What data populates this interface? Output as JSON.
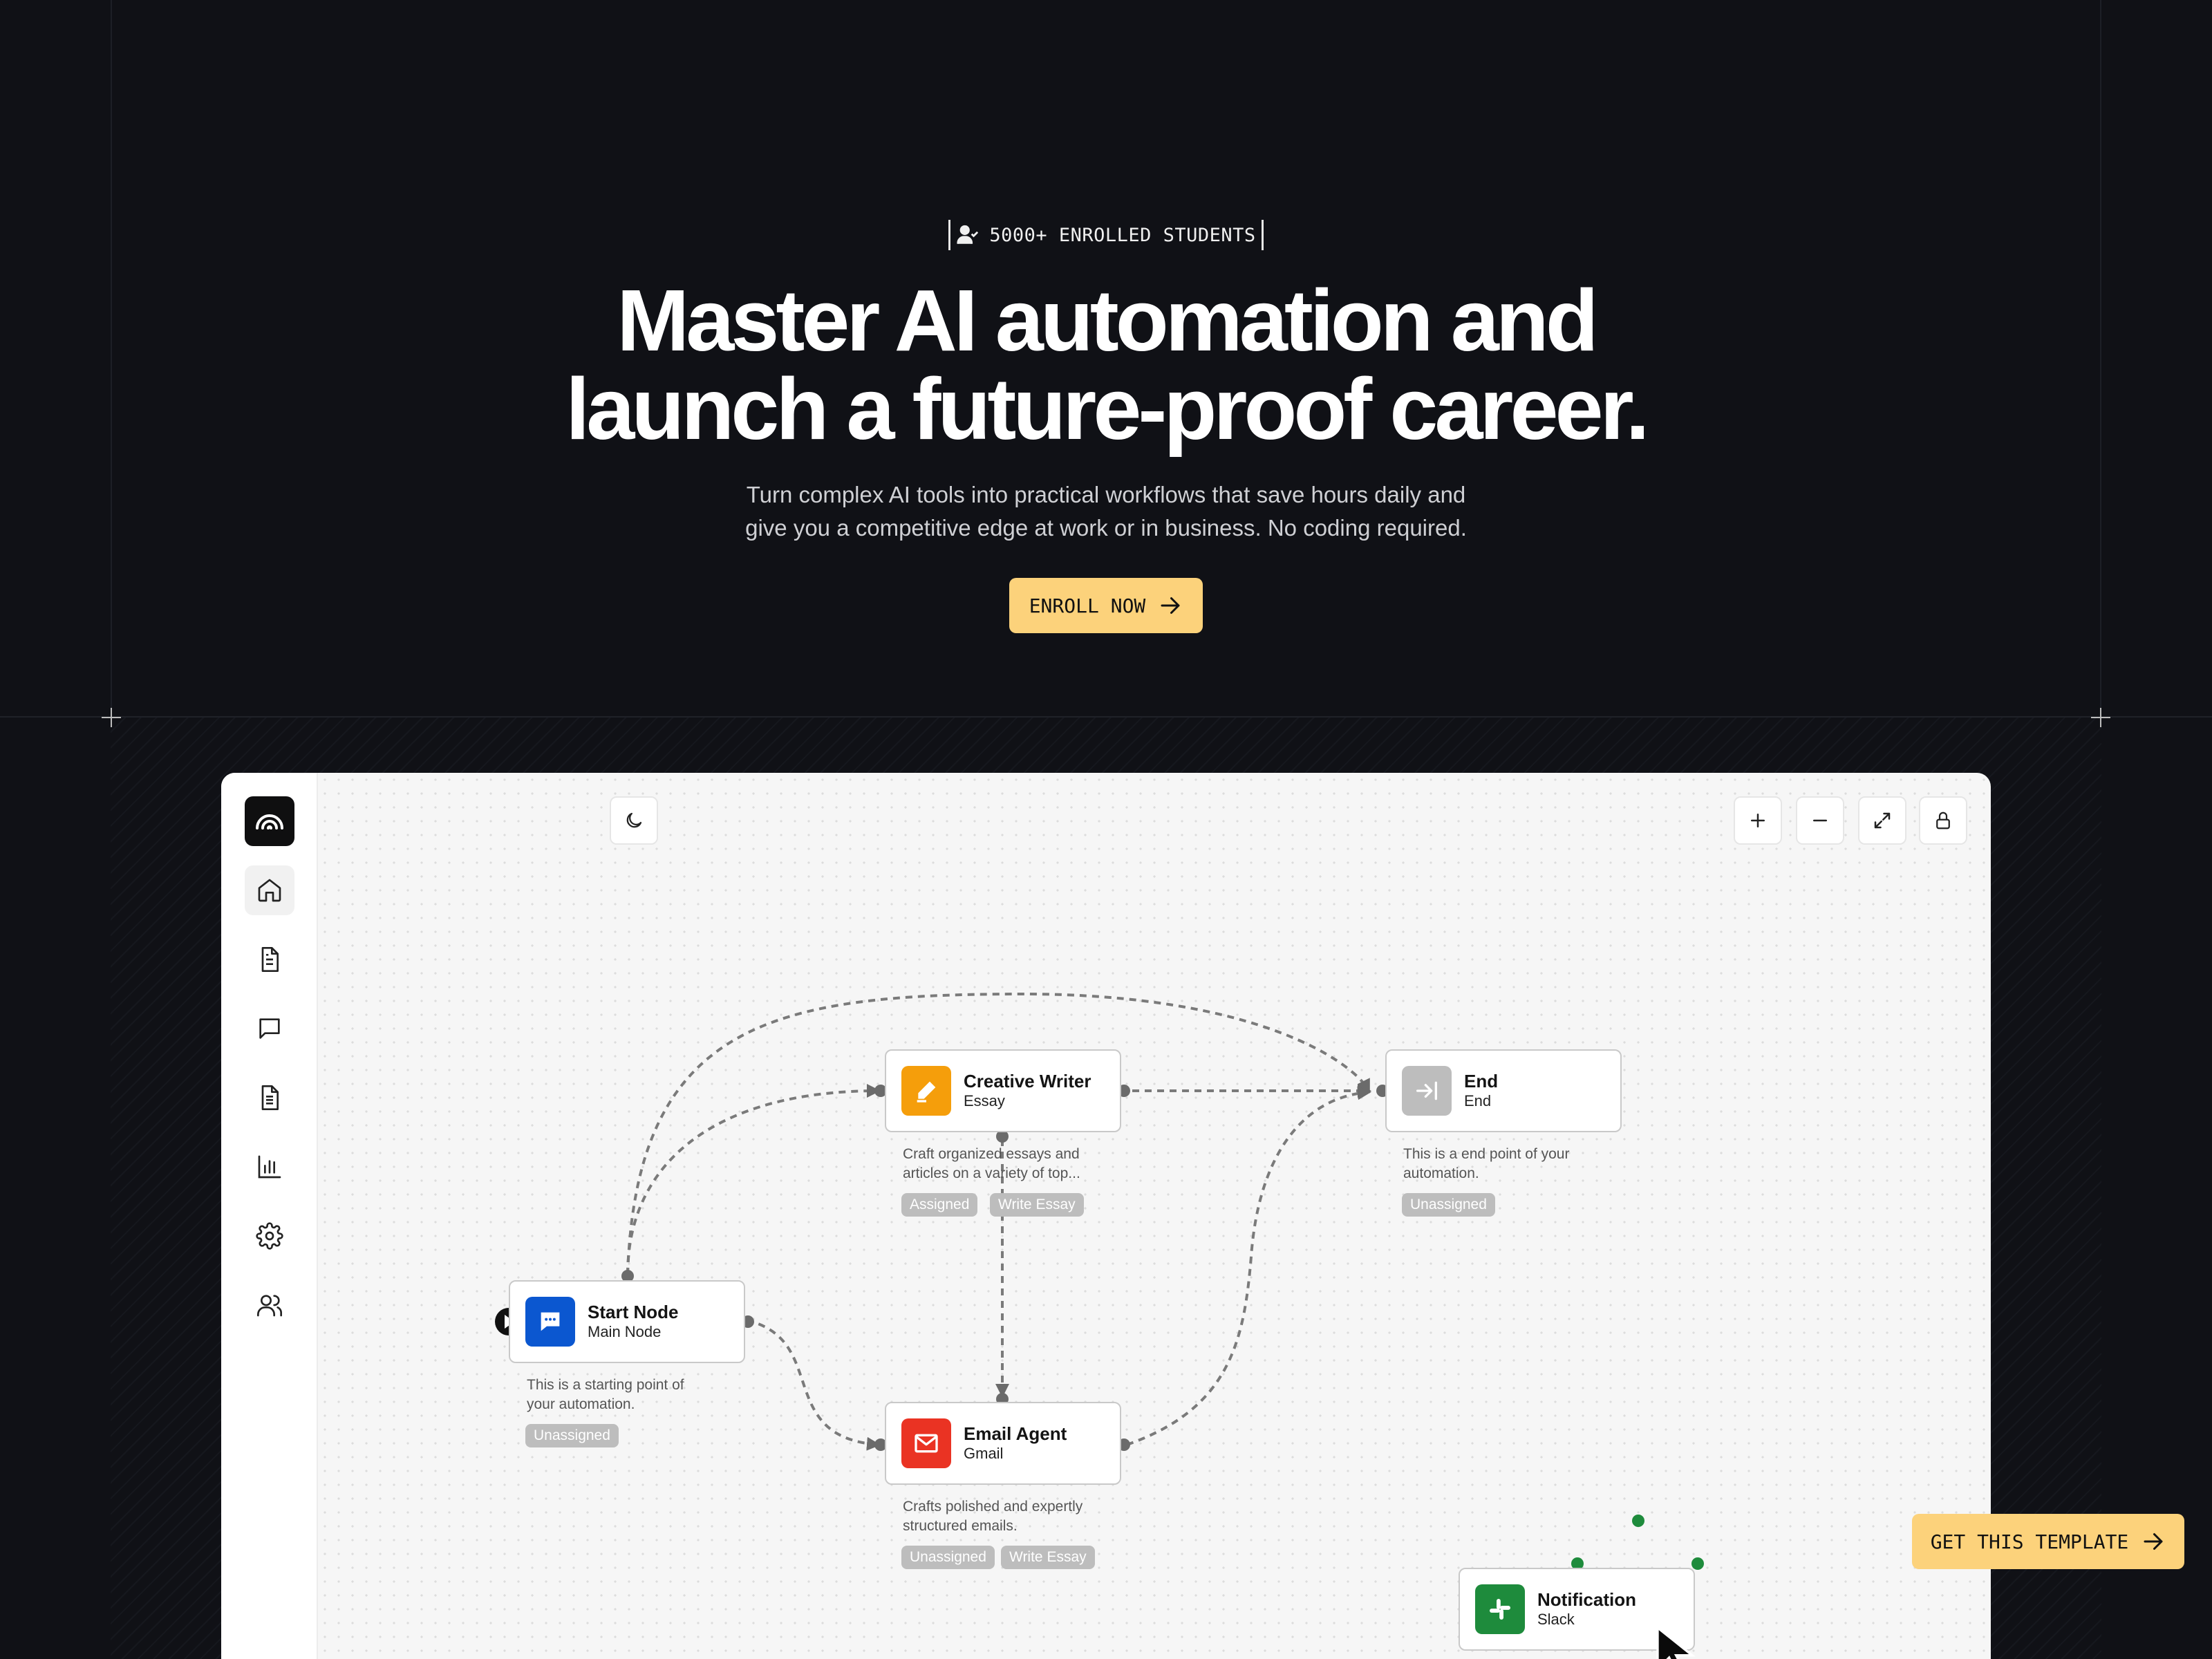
{
  "hero": {
    "badge_text": "5000+ ENROLLED STUDENTS",
    "title_line1": "Master AI automation and",
    "title_line2": "launch a future-proof career.",
    "subtitle_line1": "Turn complex AI tools into practical workflows that save hours daily and",
    "subtitle_line2": "give you a competitive edge at work or in business. No coding required.",
    "cta_label": "ENROLL NOW"
  },
  "sidebar": {
    "items": [
      {
        "icon": "home-icon"
      },
      {
        "icon": "document-icon"
      },
      {
        "icon": "chat-icon"
      },
      {
        "icon": "file-text-icon"
      },
      {
        "icon": "chart-icon"
      },
      {
        "icon": "settings-icon"
      },
      {
        "icon": "users-icon"
      }
    ]
  },
  "toolbar": {
    "theme_icon": "moon-icon",
    "zoom_in_icon": "plus-icon",
    "zoom_out_icon": "minus-icon",
    "fit_icon": "expand-icon",
    "lock_icon": "lock-icon"
  },
  "nodes": {
    "creative": {
      "title": "Creative Writer",
      "subtitle": "Essay",
      "desc_line1": "Craft organized essays and",
      "desc_line2": "articles on a variety of top...",
      "tags": [
        "Assigned",
        "Write Essay"
      ],
      "color": "#f59e0b"
    },
    "end": {
      "title": "End",
      "subtitle": "End",
      "desc_line1": "This is a end point of your",
      "desc_line2": "automation.",
      "tags": [
        "Unassigned"
      ],
      "color": "#bdbdbd"
    },
    "start": {
      "title": "Start Node",
      "subtitle": "Main Node",
      "desc_line1": "This is a starting point of",
      "desc_line2": "your automation.",
      "tags": [
        "Unassigned"
      ],
      "color": "#0b57d0"
    },
    "email": {
      "title": "Email Agent",
      "subtitle": "Gmail",
      "desc_line1": "Crafts polished and expertly",
      "desc_line2": "structured emails.",
      "tags": [
        "Unassigned",
        "Write Essay"
      ],
      "color": "#ea3323"
    },
    "notification": {
      "title": "Notification",
      "subtitle": "Slack",
      "color": "#1e8b3c"
    }
  },
  "cta_bottom": {
    "label": "GET THIS TEMPLATE"
  },
  "colors": {
    "accent": "#fcd27b",
    "background": "#101116"
  }
}
